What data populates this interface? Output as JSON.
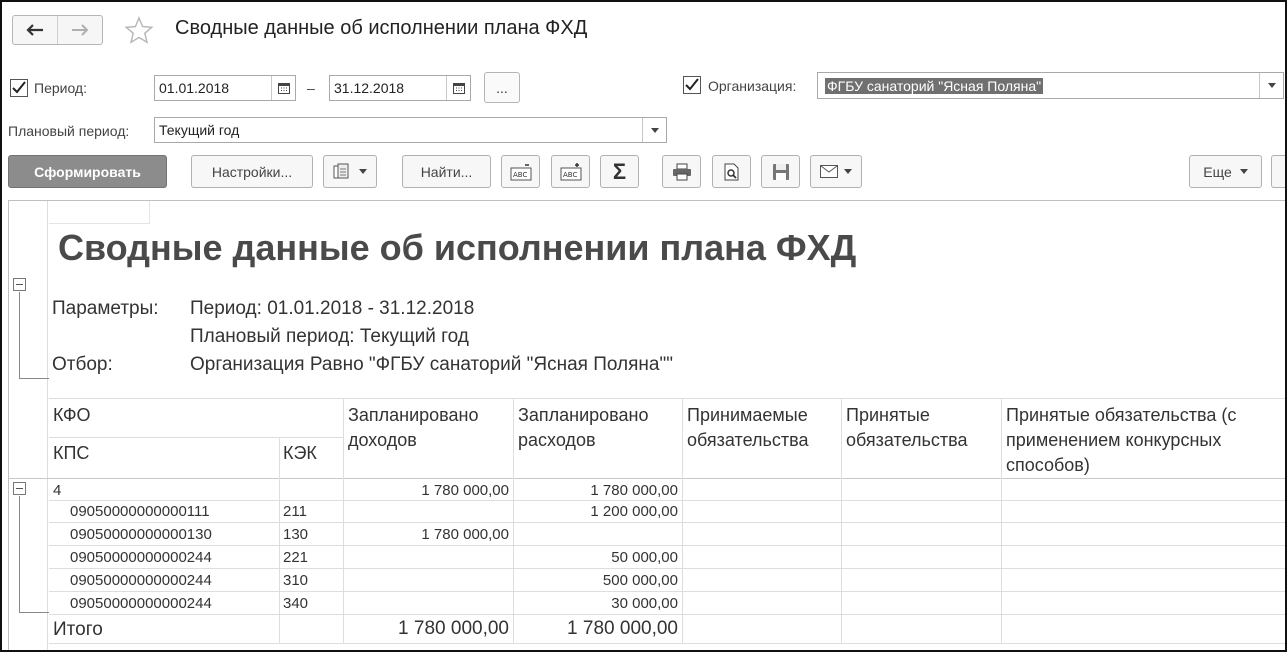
{
  "window": {
    "title": "Сводные данные об исполнении плана ФХД"
  },
  "params": {
    "period_label": "Период:",
    "date_from": "01.01.2018",
    "dash": "–",
    "date_to": "31.12.2018",
    "ellipsis": "...",
    "org_label": "Организация:",
    "org_value": "ФГБУ санаторий \"Ясная Поляна\"",
    "plan_label": "Плановый период:",
    "plan_value": "Текущий год"
  },
  "toolbar": {
    "generate": "Сформировать",
    "settings": "Настройки...",
    "find": "Найти...",
    "sum_glyph": "Σ",
    "more": "Еще"
  },
  "report": {
    "title": "Сводные данные об исполнении плана ФХД",
    "params_label": "Параметры:",
    "period_line": "Период: 01.01.2018 - 31.12.2018",
    "plan_line": "Плановый период: Текущий год",
    "filter_label": "Отбор:",
    "filter_line": "Организация Равно \"ФГБУ санаторий \"Ясная Поляна\"\"",
    "headers": {
      "kfo": "КФО",
      "kps": "КПС",
      "kek": "КЭК",
      "planned_income": "Запланировано доходов",
      "planned_expenses": "Запланировано расходов",
      "accepting_obligations": "Принимаемые обязательства",
      "accepted_obligations": "Принятые обязательства",
      "accepted_competitive": "Принятые обязательства (с применением конкурсных способов)"
    },
    "group": {
      "kfo": "4",
      "income": "1 780 000,00",
      "expenses": "1 780 000,00"
    },
    "rows": [
      {
        "kps": "09050000000000111",
        "kek": "211",
        "income": "",
        "expenses": "1 200 000,00"
      },
      {
        "kps": "09050000000000130",
        "kek": "130",
        "income": "1 780 000,00",
        "expenses": ""
      },
      {
        "kps": "09050000000000244",
        "kek": "221",
        "income": "",
        "expenses": "50 000,00"
      },
      {
        "kps": "09050000000000244",
        "kek": "310",
        "income": "",
        "expenses": "500 000,00"
      },
      {
        "kps": "09050000000000244",
        "kek": "340",
        "income": "",
        "expenses": "30 000,00"
      }
    ],
    "total": {
      "label": "Итого",
      "income": "1 780 000,00",
      "expenses": "1 780 000,00"
    }
  }
}
